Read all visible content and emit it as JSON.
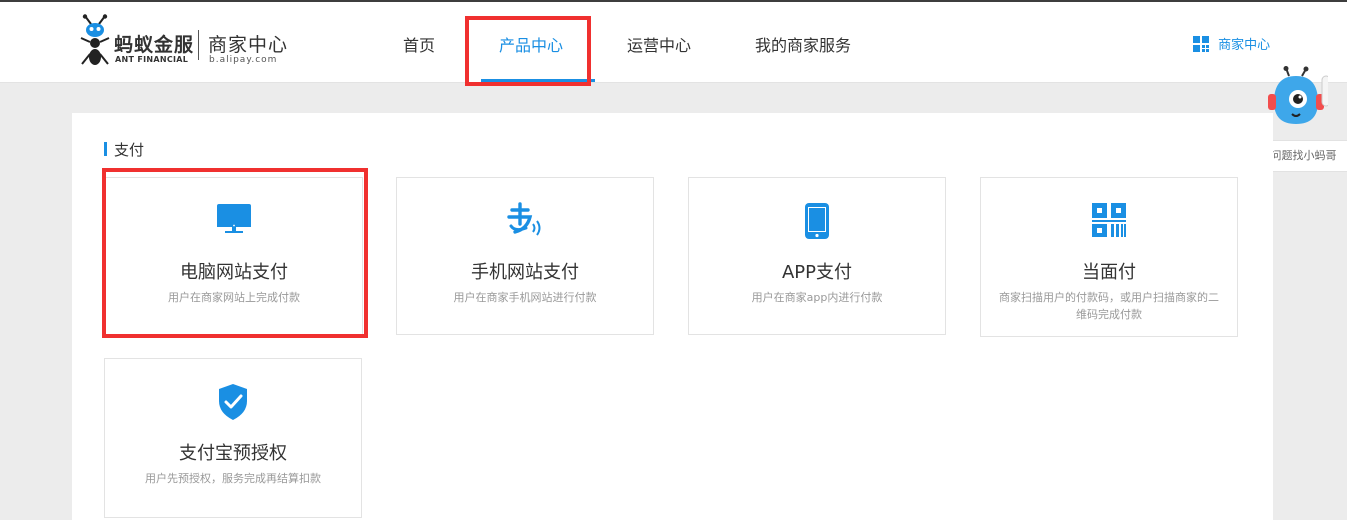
{
  "logo": {
    "brand_cn": "蚂蚁金服",
    "brand_en": "ANT FINANCIAL",
    "center_cn": "商家中心",
    "url": "b.alipay.com"
  },
  "nav": {
    "items": [
      {
        "label": "首页",
        "active": false
      },
      {
        "label": "产品中心",
        "active": true
      },
      {
        "label": "运营中心",
        "active": false
      },
      {
        "label": "我的商家服务",
        "active": false
      }
    ],
    "merchant_link": "商家中心"
  },
  "assistant": {
    "label": "有问题找小蚂哥"
  },
  "section": {
    "title": "支付"
  },
  "cards": [
    {
      "icon": "monitor-icon",
      "title": "电脑网站支付",
      "desc": "用户在商家网站上完成付款"
    },
    {
      "icon": "alipay-logo-icon",
      "title": "手机网站支付",
      "desc": "用户在商家手机网站进行付款"
    },
    {
      "icon": "phone-icon",
      "title": "APP支付",
      "desc": "用户在商家app内进行付款"
    },
    {
      "icon": "qr-code-icon",
      "title": "当面付",
      "desc": "商家扫描用户的付款码，或用户扫描商家的二维码完成付款"
    },
    {
      "icon": "shield-check-icon",
      "title": "支付宝预授权",
      "desc": "用户先预授权，服务完成再结算扣款"
    }
  ],
  "colors": {
    "accent": "#1a8fe3",
    "highlight": "#f0302f",
    "background": "#ececec"
  }
}
